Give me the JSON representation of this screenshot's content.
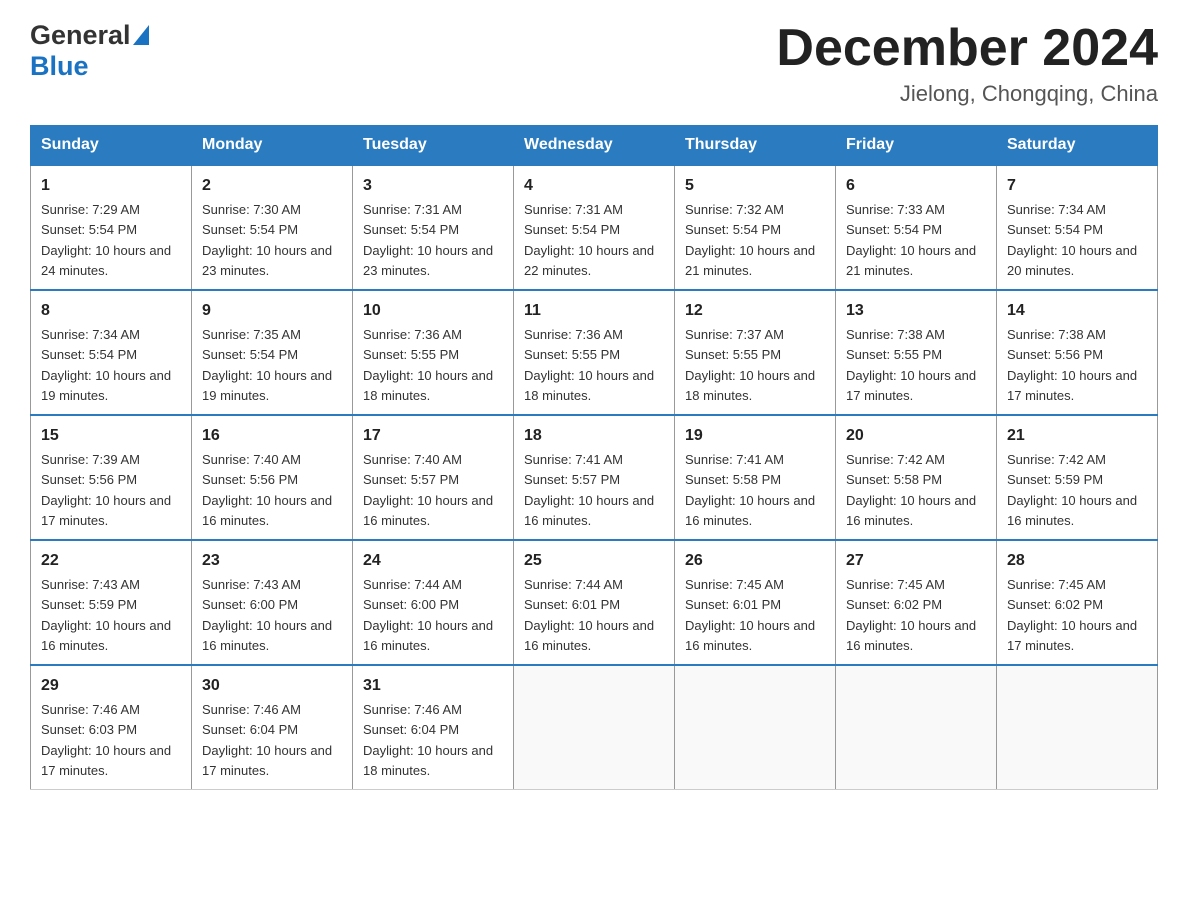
{
  "header": {
    "logo_general": "General",
    "logo_blue": "Blue",
    "title": "December 2024",
    "subtitle": "Jielong, Chongqing, China"
  },
  "days_of_week": [
    "Sunday",
    "Monday",
    "Tuesday",
    "Wednesday",
    "Thursday",
    "Friday",
    "Saturday"
  ],
  "weeks": [
    [
      {
        "day": "1",
        "sunrise": "7:29 AM",
        "sunset": "5:54 PM",
        "daylight": "10 hours and 24 minutes."
      },
      {
        "day": "2",
        "sunrise": "7:30 AM",
        "sunset": "5:54 PM",
        "daylight": "10 hours and 23 minutes."
      },
      {
        "day": "3",
        "sunrise": "7:31 AM",
        "sunset": "5:54 PM",
        "daylight": "10 hours and 23 minutes."
      },
      {
        "day": "4",
        "sunrise": "7:31 AM",
        "sunset": "5:54 PM",
        "daylight": "10 hours and 22 minutes."
      },
      {
        "day": "5",
        "sunrise": "7:32 AM",
        "sunset": "5:54 PM",
        "daylight": "10 hours and 21 minutes."
      },
      {
        "day": "6",
        "sunrise": "7:33 AM",
        "sunset": "5:54 PM",
        "daylight": "10 hours and 21 minutes."
      },
      {
        "day": "7",
        "sunrise": "7:34 AM",
        "sunset": "5:54 PM",
        "daylight": "10 hours and 20 minutes."
      }
    ],
    [
      {
        "day": "8",
        "sunrise": "7:34 AM",
        "sunset": "5:54 PM",
        "daylight": "10 hours and 19 minutes."
      },
      {
        "day": "9",
        "sunrise": "7:35 AM",
        "sunset": "5:54 PM",
        "daylight": "10 hours and 19 minutes."
      },
      {
        "day": "10",
        "sunrise": "7:36 AM",
        "sunset": "5:55 PM",
        "daylight": "10 hours and 18 minutes."
      },
      {
        "day": "11",
        "sunrise": "7:36 AM",
        "sunset": "5:55 PM",
        "daylight": "10 hours and 18 minutes."
      },
      {
        "day": "12",
        "sunrise": "7:37 AM",
        "sunset": "5:55 PM",
        "daylight": "10 hours and 18 minutes."
      },
      {
        "day": "13",
        "sunrise": "7:38 AM",
        "sunset": "5:55 PM",
        "daylight": "10 hours and 17 minutes."
      },
      {
        "day": "14",
        "sunrise": "7:38 AM",
        "sunset": "5:56 PM",
        "daylight": "10 hours and 17 minutes."
      }
    ],
    [
      {
        "day": "15",
        "sunrise": "7:39 AM",
        "sunset": "5:56 PM",
        "daylight": "10 hours and 17 minutes."
      },
      {
        "day": "16",
        "sunrise": "7:40 AM",
        "sunset": "5:56 PM",
        "daylight": "10 hours and 16 minutes."
      },
      {
        "day": "17",
        "sunrise": "7:40 AM",
        "sunset": "5:57 PM",
        "daylight": "10 hours and 16 minutes."
      },
      {
        "day": "18",
        "sunrise": "7:41 AM",
        "sunset": "5:57 PM",
        "daylight": "10 hours and 16 minutes."
      },
      {
        "day": "19",
        "sunrise": "7:41 AM",
        "sunset": "5:58 PM",
        "daylight": "10 hours and 16 minutes."
      },
      {
        "day": "20",
        "sunrise": "7:42 AM",
        "sunset": "5:58 PM",
        "daylight": "10 hours and 16 minutes."
      },
      {
        "day": "21",
        "sunrise": "7:42 AM",
        "sunset": "5:59 PM",
        "daylight": "10 hours and 16 minutes."
      }
    ],
    [
      {
        "day": "22",
        "sunrise": "7:43 AM",
        "sunset": "5:59 PM",
        "daylight": "10 hours and 16 minutes."
      },
      {
        "day": "23",
        "sunrise": "7:43 AM",
        "sunset": "6:00 PM",
        "daylight": "10 hours and 16 minutes."
      },
      {
        "day": "24",
        "sunrise": "7:44 AM",
        "sunset": "6:00 PM",
        "daylight": "10 hours and 16 minutes."
      },
      {
        "day": "25",
        "sunrise": "7:44 AM",
        "sunset": "6:01 PM",
        "daylight": "10 hours and 16 minutes."
      },
      {
        "day": "26",
        "sunrise": "7:45 AM",
        "sunset": "6:01 PM",
        "daylight": "10 hours and 16 minutes."
      },
      {
        "day": "27",
        "sunrise": "7:45 AM",
        "sunset": "6:02 PM",
        "daylight": "10 hours and 16 minutes."
      },
      {
        "day": "28",
        "sunrise": "7:45 AM",
        "sunset": "6:02 PM",
        "daylight": "10 hours and 17 minutes."
      }
    ],
    [
      {
        "day": "29",
        "sunrise": "7:46 AM",
        "sunset": "6:03 PM",
        "daylight": "10 hours and 17 minutes."
      },
      {
        "day": "30",
        "sunrise": "7:46 AM",
        "sunset": "6:04 PM",
        "daylight": "10 hours and 17 minutes."
      },
      {
        "day": "31",
        "sunrise": "7:46 AM",
        "sunset": "6:04 PM",
        "daylight": "10 hours and 18 minutes."
      },
      null,
      null,
      null,
      null
    ]
  ],
  "labels": {
    "sunrise": "Sunrise:",
    "sunset": "Sunset:",
    "daylight": "Daylight:"
  }
}
